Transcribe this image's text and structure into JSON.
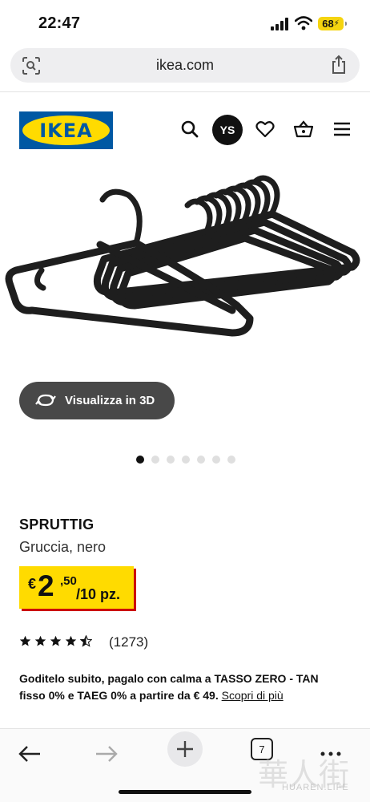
{
  "status_bar": {
    "time": "22:47",
    "battery": "68"
  },
  "browser": {
    "url": "ikea.com",
    "open_tabs": "7"
  },
  "header": {
    "logo_text": "IKEA",
    "account_initials": "YS"
  },
  "gallery": {
    "view_3d_label": "Visualizza in 3D",
    "image_count": 7,
    "active_image": 1
  },
  "product": {
    "name": "SPRUTTIG",
    "description": "Gruccia, nero",
    "price": {
      "currency": "€",
      "integer": "2",
      "decimal": ",50",
      "unit": "/10 pz."
    },
    "rating": {
      "stars": 4.5,
      "max": 5,
      "count_text": "(1273)"
    },
    "promo": {
      "text": "Goditelo subito, pagalo con calma a TASSO ZERO - TAN fisso 0% e TAEG 0% a partire da € 49.",
      "link": "Scopri di più"
    }
  },
  "watermark": {
    "text": "華人街",
    "subtext": "HUAREN.LIFE"
  },
  "colors": {
    "ikea_blue": "#0058a3",
    "ikea_yellow": "#ffdb00",
    "price_shadow_red": "#cc0008",
    "button_dark": "#484848"
  }
}
